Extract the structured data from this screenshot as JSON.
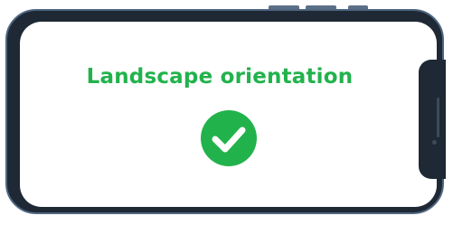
{
  "colors": {
    "frame": "#1e2935",
    "frame_border": "#4f6680",
    "accent_green": "#22b24c",
    "check_mark": "#ffffff"
  },
  "message": {
    "text": "Landscape orientation"
  },
  "status_icon": {
    "name": "check-circle-icon"
  }
}
